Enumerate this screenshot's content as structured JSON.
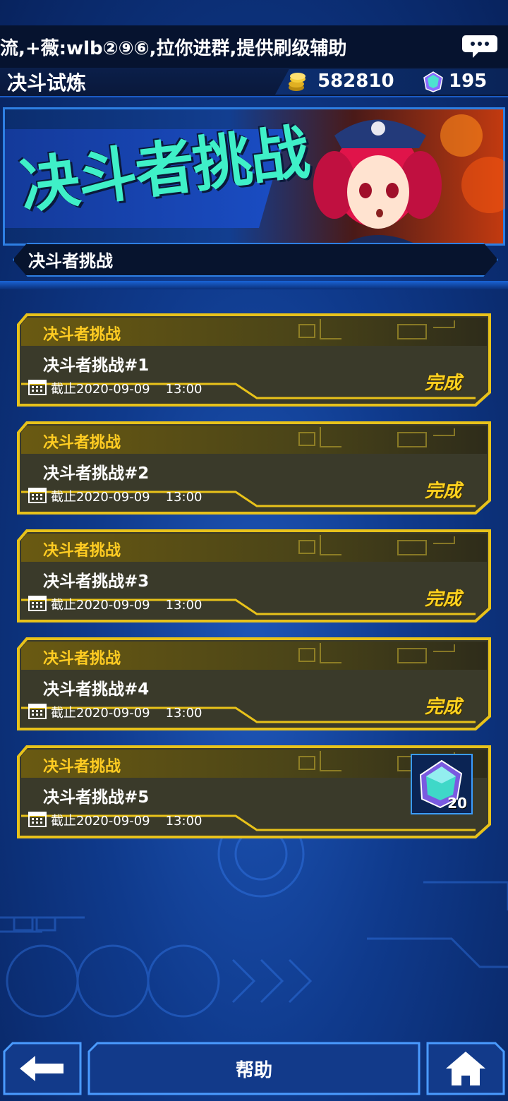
{
  "ticker": {
    "text": "流,+薇:wlb②⑨⑥,拉你进群,提供刷级辅助",
    "chat_icon": "chat-bubble-icon"
  },
  "header": {
    "title": "决斗试炼",
    "gold": "582810",
    "gems": "195"
  },
  "banner": {
    "title": "决斗者挑战",
    "label": "决斗者挑战"
  },
  "challenges": [
    {
      "category": "决斗者挑战",
      "name": "决斗者挑战#1",
      "deadline": "截止2020-09-09",
      "time": "13:00",
      "status": "完成"
    },
    {
      "category": "决斗者挑战",
      "name": "决斗者挑战#2",
      "deadline": "截止2020-09-09",
      "time": "13:00",
      "status": "完成"
    },
    {
      "category": "决斗者挑战",
      "name": "决斗者挑战#3",
      "deadline": "截止2020-09-09",
      "time": "13:00",
      "status": "完成"
    },
    {
      "category": "决斗者挑战",
      "name": "决斗者挑战#4",
      "deadline": "截止2020-09-09",
      "time": "13:00",
      "status": "完成"
    },
    {
      "category": "决斗者挑战",
      "name": "决斗者挑战#5",
      "deadline": "截止2020-09-09",
      "time": "13:00",
      "reward_qty": "20",
      "reward_icon": "gem-icon"
    }
  ],
  "footer": {
    "help_label": "帮助",
    "back_icon": "back-arrow-icon",
    "home_icon": "home-icon"
  },
  "colors": {
    "accent_gold": "#ffcc22",
    "frame_gold": "#e8c21a",
    "teal_title": "#3ff0c8",
    "ui_blue": "#2e7fe3"
  }
}
